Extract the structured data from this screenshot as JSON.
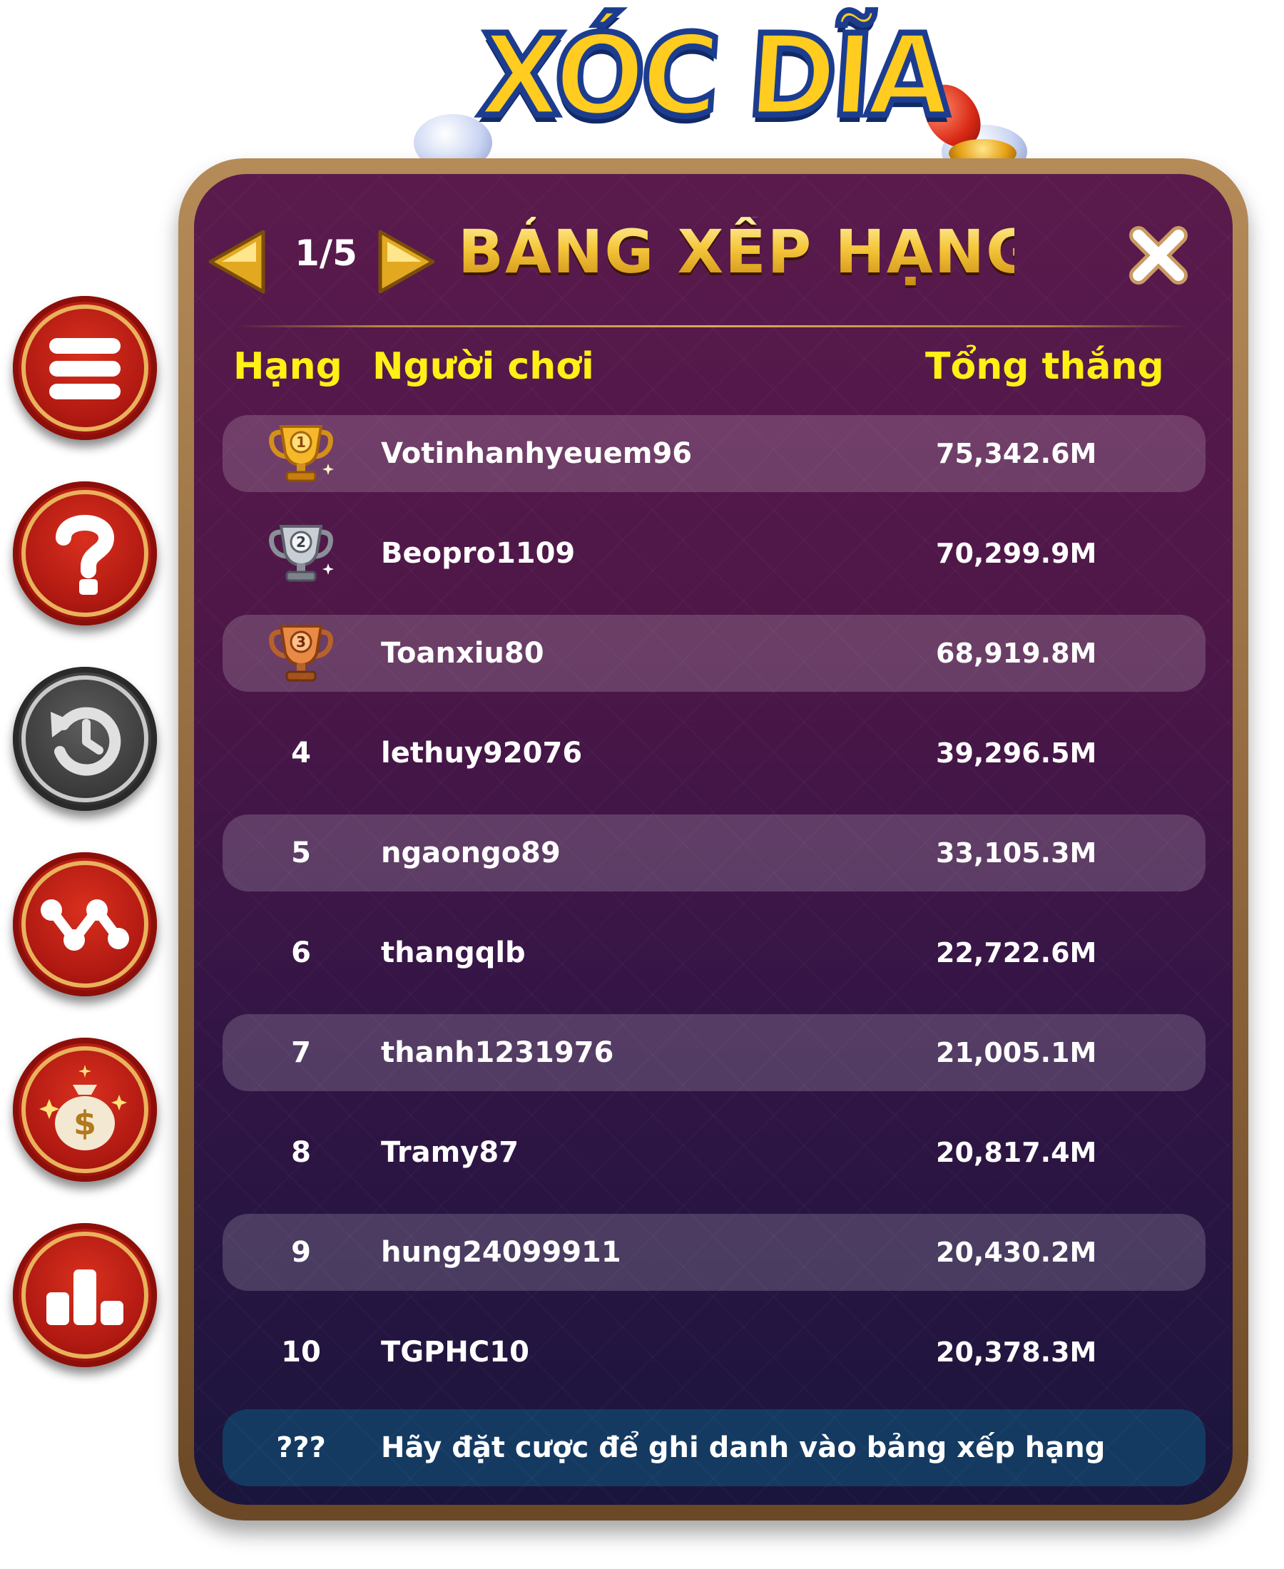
{
  "logo": {
    "text": "XÓC DĨA"
  },
  "side_menu": [
    {
      "name": "menu-icon"
    },
    {
      "name": "help-icon"
    },
    {
      "name": "history-icon"
    },
    {
      "name": "trend-chart-icon"
    },
    {
      "name": "money-bag-icon"
    },
    {
      "name": "leaderboard-icon"
    }
  ],
  "leaderboard": {
    "title": "BẢNG XẾP HẠNG",
    "page_indicator": "1/5",
    "columns": {
      "rank": "Hạng",
      "player": "Người chơi",
      "total": "Tổng thắng"
    },
    "rows": [
      {
        "rank": "1",
        "trophy": "gold",
        "player": "Votinhanhyeuem96",
        "total": "75,342.6M"
      },
      {
        "rank": "2",
        "trophy": "silver",
        "player": "Beopro1109",
        "total": "70,299.9M"
      },
      {
        "rank": "3",
        "trophy": "bronze",
        "player": "Toanxiu80",
        "total": "68,919.8M"
      },
      {
        "rank": "4",
        "player": "lethuy92076",
        "total": "39,296.5M"
      },
      {
        "rank": "5",
        "player": "ngaongo89",
        "total": "33,105.3M"
      },
      {
        "rank": "6",
        "player": "thangqlb",
        "total": "22,722.6M"
      },
      {
        "rank": "7",
        "player": "thanh1231976",
        "total": "21,005.1M"
      },
      {
        "rank": "8",
        "player": "Tramy87",
        "total": "20,817.4M"
      },
      {
        "rank": "9",
        "player": "hung24099911",
        "total": "20,430.2M"
      },
      {
        "rank": "10",
        "player": "TGPHC10",
        "total": "20,378.3M"
      }
    ],
    "my_row": {
      "rank": "???",
      "message": "Hãy đặt cược để ghi danh vào bảng xếp hạng"
    }
  },
  "colors": {
    "title_gold": "#f5c63a",
    "header_yellow": "#fff015",
    "panel_frame": "#8a6238",
    "button_red": "#b21a12",
    "my_row_blue": "#143a62"
  }
}
